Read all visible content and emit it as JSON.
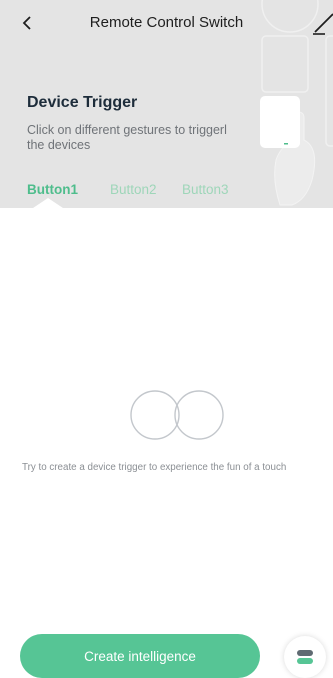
{
  "nav": {
    "title": "Remote Control Switch",
    "back_icon": "chevron-left-icon",
    "edit_icon": "pencil-icon"
  },
  "trigger": {
    "title": "Device Trigger",
    "description": "Click on different gestures to triggerl the devices"
  },
  "tabs": [
    {
      "label": "Button1",
      "active": true
    },
    {
      "label": "Button2",
      "active": false
    },
    {
      "label": "Button3",
      "active": false
    }
  ],
  "empty_state": {
    "icon": "two-circles-icon",
    "text": "Try to create a device trigger to experience the fun of a touch"
  },
  "actions": {
    "create_label": "Create intelligence",
    "fab_icon": "menu-toggle-icon"
  },
  "colors": {
    "accent": "#56c595",
    "header_bg": "#e4e4e4",
    "title_dark": "#1d2c3a"
  }
}
